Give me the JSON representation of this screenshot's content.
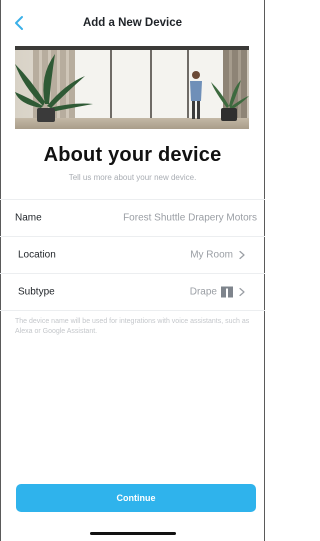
{
  "nav": {
    "title": "Add a New Device",
    "back_icon": "chevron-left-icon"
  },
  "hero": {
    "image": "living-room-curtains-photo"
  },
  "content": {
    "headline": "About your device",
    "subhead": "Tell us more about your new device."
  },
  "form": {
    "rows": [
      {
        "label": "Name",
        "value": "Forest Shuttle Drapery Motors"
      },
      {
        "label": "Location",
        "value": "My Room"
      },
      {
        "label": "Subtype",
        "value": "Drape",
        "icon": "drape-icon"
      }
    ]
  },
  "helper_text": "The device name will be used for integrations with voice assistants, such as Alexa or Google Assistant.",
  "footer": {
    "continue_label": "Continue"
  },
  "colors": {
    "accent": "#2fb3ec",
    "back_chevron": "#3ab0e8",
    "muted_text": "#9a9ea4",
    "divider": "#eceef0"
  }
}
